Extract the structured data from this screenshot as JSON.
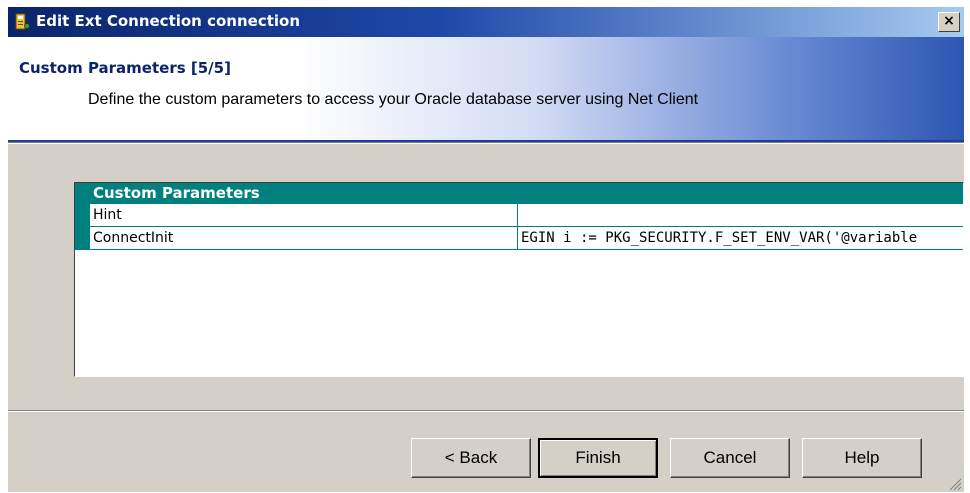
{
  "window": {
    "title": "Edit Ext Connection connection",
    "close_label": "×"
  },
  "header": {
    "title": "Custom Parameters [5/5]",
    "description": "Define the custom parameters to access your Oracle database server using Net Client"
  },
  "grid": {
    "header_label": "Custom Parameters",
    "rows": [
      {
        "name": "Hint",
        "value": ""
      },
      {
        "name": "ConnectInit",
        "value": "EGIN i := PKG_SECURITY.F_SET_ENV_VAR('@variable"
      }
    ]
  },
  "buttons": {
    "back": "< Back",
    "finish": "Finish",
    "cancel": "Cancel",
    "help": "Help"
  },
  "colors": {
    "title_bar": "#0a246a",
    "grid_accent": "#00807f",
    "dialog_face": "#d4d0c8"
  },
  "icons": {
    "title": "connection-icon",
    "close": "close-icon",
    "resize": "resize-grip-icon"
  }
}
